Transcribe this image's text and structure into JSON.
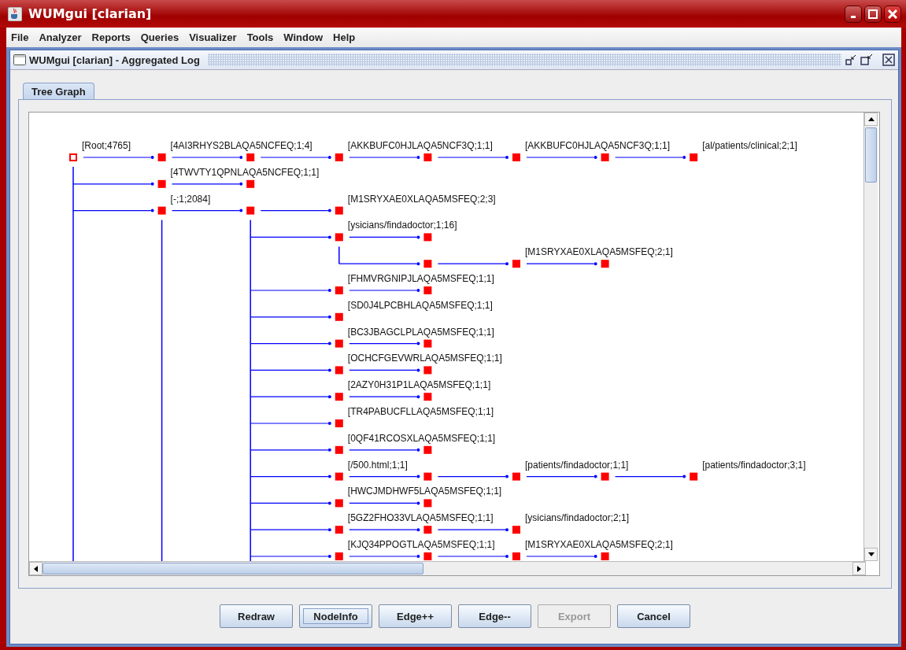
{
  "window": {
    "title": "WUMgui [clarian]"
  },
  "menu": [
    "File",
    "Analyzer",
    "Reports",
    "Queries",
    "Visualizer",
    "Tools",
    "Window",
    "Help"
  ],
  "frame": {
    "title": "WUMgui [clarian] - Aggregated Log"
  },
  "tabs": [
    {
      "label": "Tree Graph",
      "selected": true
    }
  ],
  "graph": {
    "root": {
      "label": "[Root;4765]",
      "selected": true,
      "more_below": true,
      "children": [
        {
          "label": "[4AI3RHYS2BLAQA5NCFEQ;1;4]",
          "selected": false,
          "children": [
            {
              "selected": false,
              "children": [
                {
                  "label": "[AKKBUFC0HJLAQA5NCF3Q;1;1]",
                  "selected": false,
                  "children": [
                    {
                      "selected": false,
                      "children": [
                        {
                          "label": "[AKKBUFC0HJLAQA5NCF3Q;1;1]",
                          "selected": false,
                          "children": [
                            {
                              "selected": false,
                              "children": [
                                {
                                  "label": "[al/patients/clinical;2;1]",
                                  "selected": false
                                }
                              ]
                            }
                          ]
                        }
                      ]
                    }
                  ]
                }
              ]
            }
          ]
        },
        {
          "label": "[4TWVTY1QPNLAQA5NCFEQ;1;1]",
          "selected": false,
          "children": [
            {
              "selected": false
            }
          ]
        },
        {
          "label": "[-;1;2084]",
          "selected": false,
          "more_below": true,
          "children": [
            {
              "selected": false,
              "more_below": true,
              "children": [
                {
                  "label": "[M1SRYXAE0XLAQA5MSFEQ;2;3]",
                  "selected": false
                },
                {
                  "label": "[ysicians/findadoctor;1;16]",
                  "selected": false,
                  "children": [
                    {
                      "selected": false
                    },
                    {
                      "selected": false,
                      "children": [
                        {
                          "label": "[M1SRYXAE0XLAQA5MSFEQ;2;1]",
                          "selected": false,
                          "children": [
                            {
                              "selected": false
                            }
                          ]
                        }
                      ]
                    }
                  ]
                },
                {
                  "label": "[FHMVRGNIPJLAQA5MSFEQ;1;1]",
                  "selected": false,
                  "children": [
                    {
                      "selected": false
                    }
                  ]
                },
                {
                  "label": "[SD0J4LPCBHLAQA5MSFEQ;1;1]",
                  "selected": false
                },
                {
                  "label": "[BC3JBAGCLPLAQA5MSFEQ;1;1]",
                  "selected": false,
                  "children": [
                    {
                      "selected": false
                    }
                  ]
                },
                {
                  "label": "[OCHCFGEVWRLAQA5MSFEQ;1;1]",
                  "selected": false,
                  "children": [
                    {
                      "selected": false
                    }
                  ]
                },
                {
                  "label": "[2AZY0H31P1LAQA5MSFEQ;1;1]",
                  "selected": false,
                  "children": [
                    {
                      "selected": false
                    }
                  ]
                },
                {
                  "label": "[TR4PABUCFLLAQA5MSFEQ;1;1]",
                  "selected": false
                },
                {
                  "label": "[0QF41RCOSXLAQA5MSFEQ;1;1]",
                  "selected": false,
                  "children": [
                    {
                      "selected": false
                    }
                  ]
                },
                {
                  "label": "[/500.html;1;1]",
                  "selected": false,
                  "children": [
                    {
                      "selected": false,
                      "children": [
                        {
                          "label": "[patients/findadoctor;1;1]",
                          "selected": false,
                          "children": [
                            {
                              "selected": false,
                              "children": [
                                {
                                  "label": "[patients/findadoctor;3;1]",
                                  "selected": false
                                }
                              ]
                            }
                          ]
                        }
                      ]
                    }
                  ]
                },
                {
                  "label": "[HWCJMDHWF5LAQA5MSFEQ;1;1]",
                  "selected": false,
                  "children": [
                    {
                      "selected": false
                    }
                  ]
                },
                {
                  "label": "[5GZ2FHO33VLAQA5MSFEQ;1;1]",
                  "selected": false,
                  "children": [
                    {
                      "selected": false,
                      "children": [
                        {
                          "label": "[ysicians/findadoctor;2;1]",
                          "selected": false
                        }
                      ]
                    }
                  ]
                },
                {
                  "label": "[KJQ34PPOGTLAQA5MSFEQ;1;1]",
                  "selected": false,
                  "children": [
                    {
                      "selected": false,
                      "children": [
                        {
                          "label": "[M1SRYXAE0XLAQA5MSFEQ;2;1]",
                          "selected": false,
                          "children": [
                            {
                              "selected": false
                            }
                          ]
                        }
                      ]
                    }
                  ]
                }
              ]
            }
          ]
        }
      ]
    }
  },
  "buttons": [
    {
      "label": "Redraw",
      "disabled": false,
      "focused": false
    },
    {
      "label": "NodeInfo",
      "disabled": false,
      "focused": true
    },
    {
      "label": "Edge++",
      "disabled": false,
      "focused": false
    },
    {
      "label": "Edge--",
      "disabled": false,
      "focused": false
    },
    {
      "label": "Export",
      "disabled": true,
      "focused": false
    },
    {
      "label": "Cancel",
      "disabled": false,
      "focused": false
    }
  ]
}
